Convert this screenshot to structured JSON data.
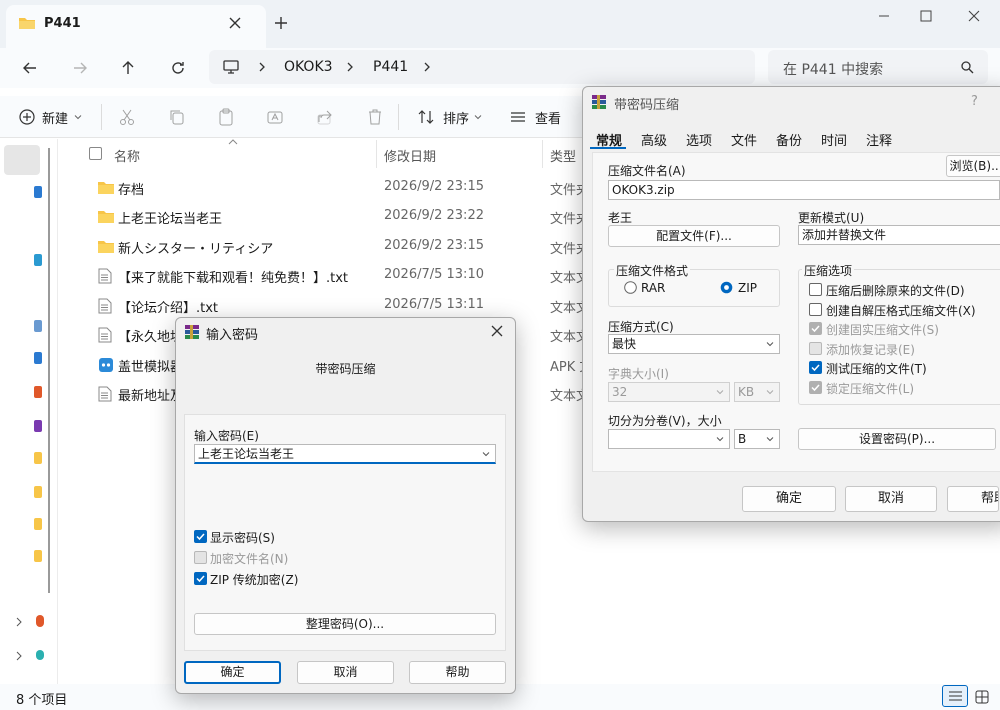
{
  "explorer": {
    "tab_title": "P441",
    "breadcrumb": [
      "OKOK3",
      "P441"
    ],
    "search_placeholder": "在 P441 中搜索",
    "cmd": {
      "new_label": "新建",
      "sort_label": "排序",
      "view_label": "查看"
    },
    "columns": {
      "name": "名称",
      "modified": "修改日期",
      "type": "类型"
    },
    "rows": [
      {
        "icon": "folder-icon",
        "name": "存档",
        "date": "2026/9/2 23:15",
        "type": "文件夹"
      },
      {
        "icon": "folder-icon",
        "name": "上老王论坛当老王",
        "date": "2026/9/2 23:22",
        "type": "文件夹"
      },
      {
        "icon": "folder-icon",
        "name": "新人シスター・リティシア",
        "date": "2026/9/2 23:15",
        "type": "文件夹"
      },
      {
        "icon": "text-file-icon",
        "name": "【来了就能下载和观看！纯免费！】.txt",
        "date": "2026/7/5 13:10",
        "type": "文本文"
      },
      {
        "icon": "text-file-icon",
        "name": "【论坛介绍】.txt",
        "date": "2026/7/5 13:11",
        "type": "文本文"
      },
      {
        "icon": "text-file-icon",
        "name": "【永久地址",
        "date": "",
        "type": "文本文"
      },
      {
        "icon": "apk-icon",
        "name": "盖世模拟器",
        "date": "",
        "type": "APK 文"
      },
      {
        "icon": "text-file-icon",
        "name": "最新地址及",
        "date": "",
        "type": "文本文"
      }
    ],
    "status": "8 个项目"
  },
  "archive_dialog": {
    "title": "带密码压缩",
    "help": "?",
    "tabs": [
      "常规",
      "高级",
      "选项",
      "文件",
      "备份",
      "时间",
      "注释"
    ],
    "archive_name_label": "压缩文件名(A)",
    "archive_name_value": "OKOK3.zip",
    "browse": "浏览(B)...",
    "profile_group": "老王",
    "profile_button": "配置文件(F)...",
    "update_mode_label": "更新模式(U)",
    "update_mode_value": "添加并替换文件",
    "format_group": "压缩文件格式",
    "format_rar": "RAR",
    "format_zip": "ZIP",
    "options_group": "压缩选项",
    "options": [
      {
        "label": "压缩后删除原来的文件(D)",
        "checked": false,
        "disabled": false
      },
      {
        "label": "创建自解压格式压缩文件(X)",
        "checked": false,
        "disabled": false
      },
      {
        "label": "创建固实压缩文件(S)",
        "checked": true,
        "disabled": true
      },
      {
        "label": "添加恢复记录(E)",
        "checked": false,
        "disabled": true
      },
      {
        "label": "测试压缩的文件(T)",
        "checked": true,
        "disabled": false
      },
      {
        "label": "锁定压缩文件(L)",
        "checked": true,
        "disabled": true
      }
    ],
    "method_label": "压缩方式(C)",
    "method_value": "最快",
    "dict_label": "字典大小(I)",
    "dict_value": "32",
    "dict_unit": "KB",
    "split_label": "切分为分卷(V)，大小",
    "split_value": "",
    "split_unit": "B",
    "set_password": "设置密码(P)...",
    "ok": "确定",
    "cancel": "取消",
    "help_button": "帮助"
  },
  "password_dialog": {
    "title": "输入密码",
    "subtitle": "带密码压缩",
    "password_label": "输入密码(E)",
    "password_value": "上老王论坛当老王",
    "show_password": "显示密码(S)",
    "encrypt_names": "加密文件名(N)",
    "zip_legacy": "ZIP 传统加密(Z)",
    "organize": "整理密码(O)...",
    "ok": "确定",
    "cancel": "取消",
    "help": "帮助"
  },
  "colors": {
    "accent": "#0067c0",
    "folder": "#f7c548",
    "winrar": "#7a2a8a"
  }
}
